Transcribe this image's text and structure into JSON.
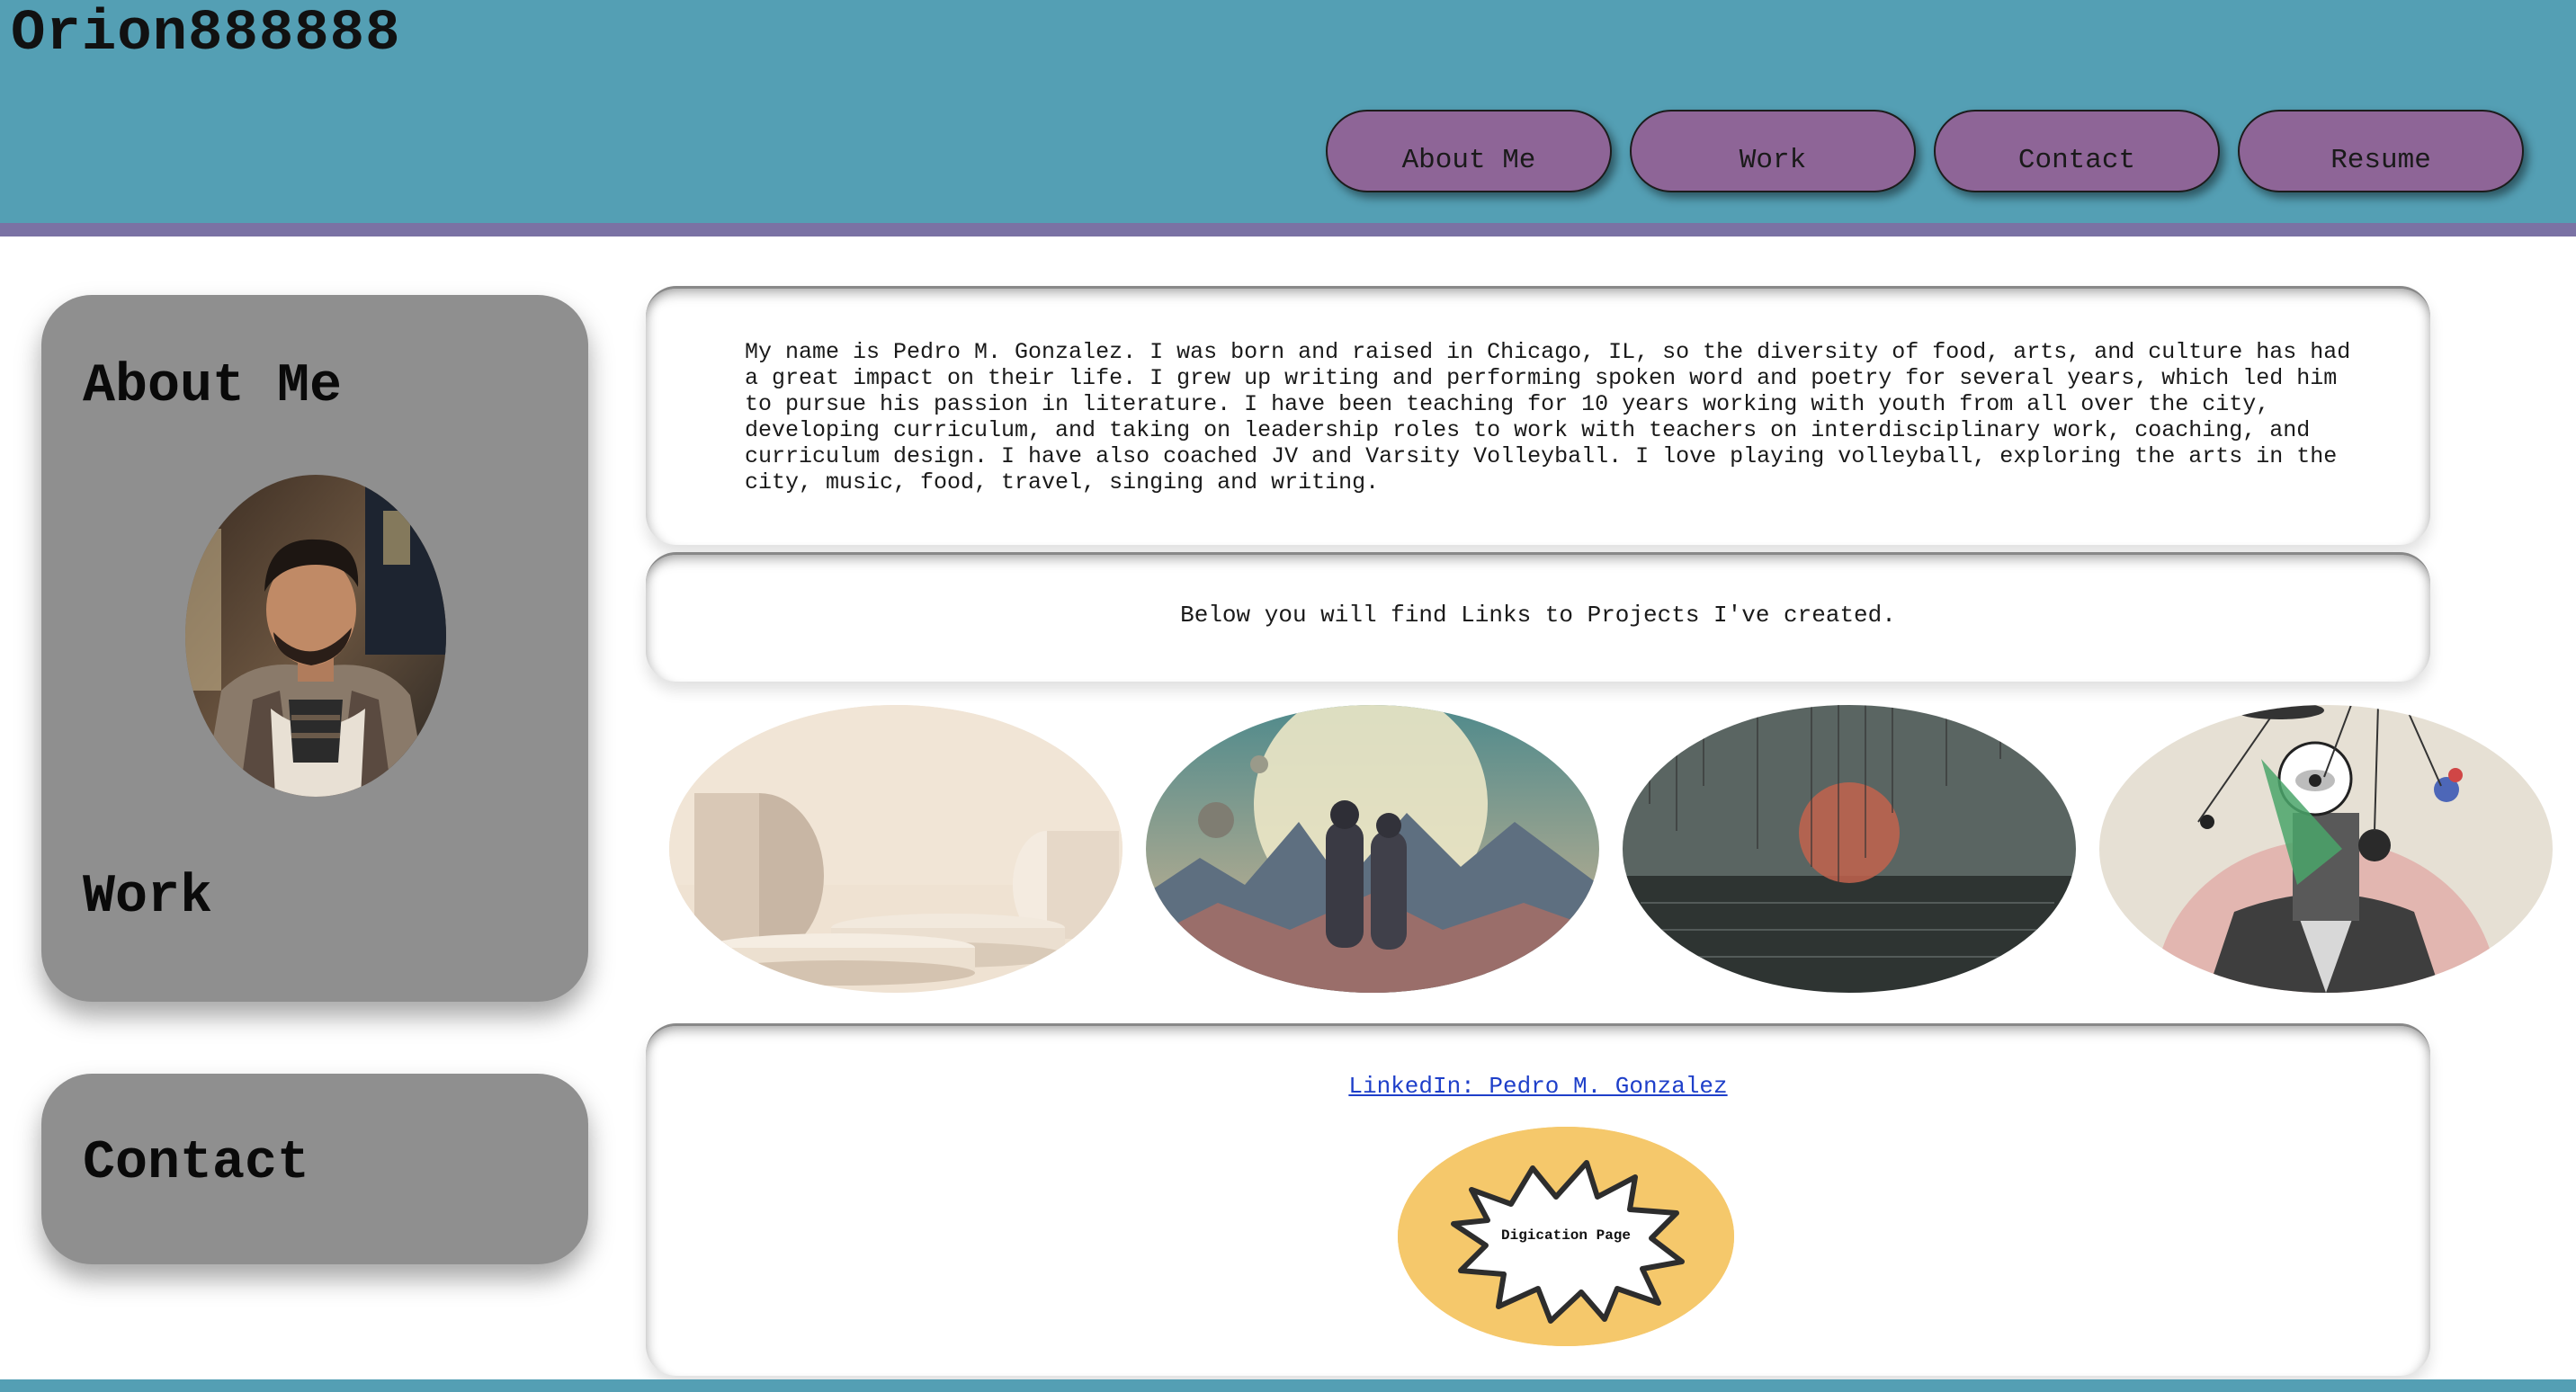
{
  "header": {
    "brand": "Orion888888",
    "nav": [
      "About Me",
      "Work",
      "Contact",
      "Resume"
    ]
  },
  "sidebar": {
    "about_title": "About Me",
    "work_title": "Work",
    "contact_title": "Contact"
  },
  "main": {
    "bio": "My name is Pedro M. Gonzalez. I was born and raised in Chicago, IL, so the diversity of food, arts, and culture has had a great impact on their life. I grew up writing and performing spoken word and poetry for several years, which led him to pursue his passion in literature. I have been teaching for 10 years working with youth from all over the city, developing curriculum, and taking on leadership roles to work with teachers on interdisciplinary work, coaching, and curriculum design. I have also coached JV and Varsity Volleyball. I love playing volleyball, exploring the arts in the city, music, food, travel, singing and writing.",
    "projects_intro": "Below you will find Links to Projects I've created.",
    "linkedin_label": "LinkedIn: Pedro M. Gonzalez",
    "digication_label": "Digication Page"
  },
  "colors": {
    "header": "#549fb4",
    "stripe": "#7a72a4",
    "nav_button": "#8e6597",
    "sidebar_card": "#8f8f8f",
    "link": "#1e3fc9"
  }
}
